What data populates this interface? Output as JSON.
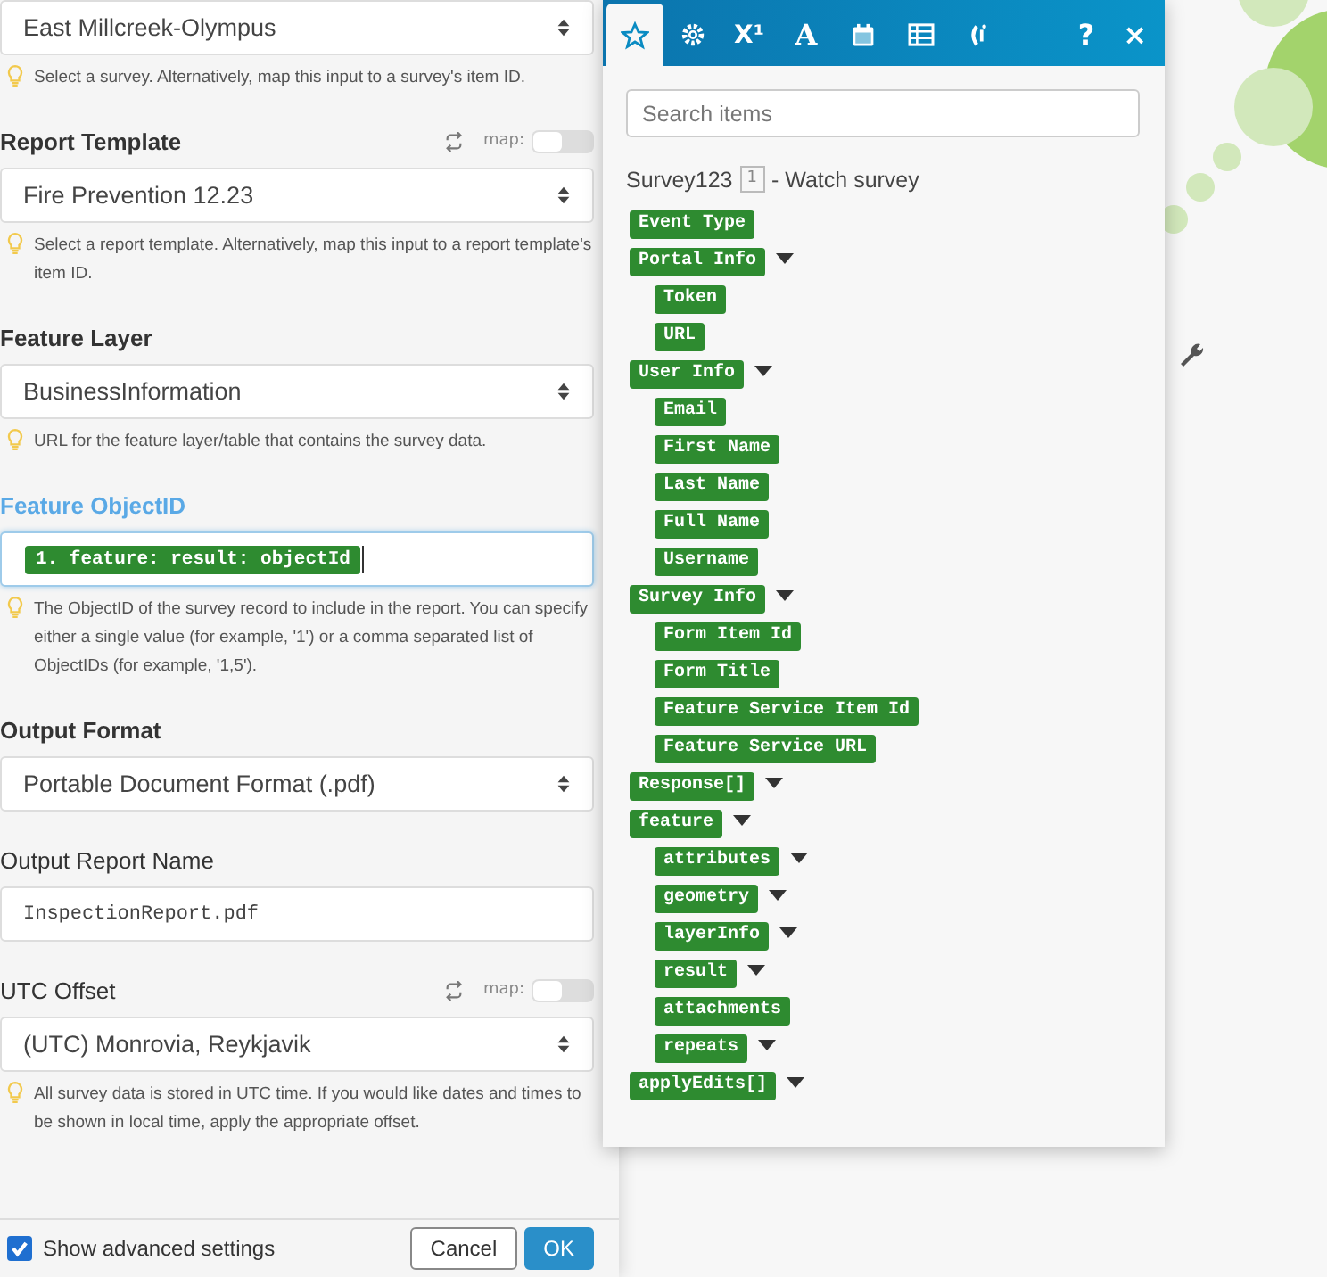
{
  "form": {
    "fields": [
      {
        "kind": "select",
        "focused": false,
        "value": "East Millcreek-Olympus",
        "hint": "Select a survey. Alternatively, map this input to a survey's item ID."
      },
      {
        "kind": "select",
        "label": "Report Template",
        "required": true,
        "focused": false,
        "map_toggle": {
          "label": "map:",
          "on": false
        },
        "value": "Fire Prevention 12.23",
        "hint": "Select a report template. Alternatively, map this input to a report template's item ID."
      },
      {
        "kind": "select",
        "label": "Feature Layer",
        "required": true,
        "focused": false,
        "value": "BusinessInformation",
        "hint": "URL for the feature layer/table that contains the survey data."
      },
      {
        "kind": "mapped",
        "label": "Feature ObjectID",
        "required": true,
        "focused": true,
        "value": "1. feature: result: objectId",
        "hint": "The ObjectID of the survey record to include in the report. You can specify either a single value (for example, '1') or a comma separated list of ObjectIDs (for example, '1,5')."
      },
      {
        "kind": "select",
        "label": "Output Format",
        "required": true,
        "focused": false,
        "value": "Portable Document Format (.pdf)"
      },
      {
        "kind": "text",
        "label": "Output Report Name",
        "required": false,
        "focused": false,
        "value": "InspectionReport.pdf"
      },
      {
        "kind": "select",
        "label": "UTC Offset",
        "required": false,
        "focused": false,
        "map_toggle": {
          "label": "map:",
          "on": false
        },
        "value": "(UTC) Monrovia, Reykjavik",
        "hint": "All survey data is stored in UTC time. If you would like dates and times to be shown in local time, apply the appropriate offset."
      }
    ],
    "advanced": {
      "label": "Show advanced settings",
      "checked": true
    },
    "buttons": [
      {
        "kind": "secondary",
        "label": "Cancel"
      },
      {
        "kind": "primary",
        "label": "OK"
      }
    ]
  },
  "picker": {
    "tabs": [
      {
        "kind": "favorites",
        "selected": true
      },
      {
        "kind": "functions",
        "selected": false
      },
      {
        "kind": "math",
        "label": "X¹",
        "selected": false
      },
      {
        "kind": "text",
        "label": "A",
        "selected": false
      },
      {
        "kind": "date",
        "selected": false
      },
      {
        "kind": "array",
        "selected": false
      },
      {
        "kind": "custom",
        "selected": false
      }
    ],
    "help": "?",
    "close": "×",
    "search": {
      "placeholder": "Search items"
    },
    "module": {
      "name": "Survey123",
      "badge": "1",
      "action": "- Watch survey"
    },
    "items": [
      {
        "label": "Event Type",
        "expandable": false
      },
      {
        "label": "Portal Info",
        "expandable": true,
        "children": [
          {
            "label": "Token",
            "expandable": false
          },
          {
            "label": "URL",
            "expandable": false
          }
        ]
      },
      {
        "label": "User Info",
        "expandable": true,
        "children": [
          {
            "label": "Email",
            "expandable": false
          },
          {
            "label": "First Name",
            "expandable": false
          },
          {
            "label": "Last Name",
            "expandable": false
          },
          {
            "label": "Full Name",
            "expandable": false
          },
          {
            "label": "Username",
            "expandable": false
          }
        ]
      },
      {
        "label": "Survey Info",
        "expandable": true,
        "children": [
          {
            "label": "Form Item Id",
            "expandable": false
          },
          {
            "label": "Form Title",
            "expandable": false
          },
          {
            "label": "Feature Service Item Id",
            "expandable": false
          },
          {
            "label": "Feature Service URL",
            "expandable": false
          }
        ]
      },
      {
        "label": "Response[]",
        "expandable": true
      },
      {
        "label": "feature",
        "expandable": true,
        "children": [
          {
            "label": "attributes",
            "expandable": true
          },
          {
            "label": "geometry",
            "expandable": true
          },
          {
            "label": "layerInfo",
            "expandable": true
          },
          {
            "label": "result",
            "expandable": true
          },
          {
            "label": "attachments",
            "expandable": false
          },
          {
            "label": "repeats",
            "expandable": true
          }
        ]
      },
      {
        "label": "applyEdits[]",
        "expandable": true
      }
    ]
  }
}
